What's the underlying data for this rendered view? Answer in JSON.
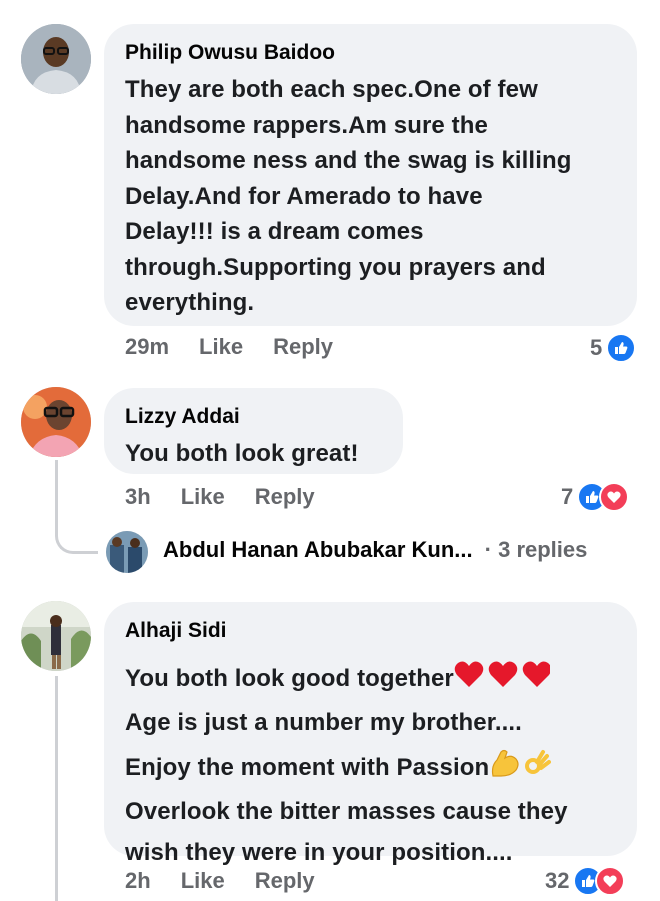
{
  "comments": [
    {
      "author": "Philip Owusu Baidoo",
      "lines": [
        "They are both each spec.One of few",
        "handsome rappers.Am sure the",
        "handsome ness and the swag is killing",
        "Delay.And for Amerado to have",
        "Delay!!! is a dream comes",
        "through.Supporting you prayers and",
        "everything."
      ],
      "time": "29m",
      "like_label": "Like",
      "reply_label": "Reply",
      "reaction_count": "5",
      "reactions": [
        "like-icon"
      ]
    },
    {
      "author": "Lizzy Addai",
      "lines": [
        "You both look great!"
      ],
      "time": "3h",
      "like_label": "Like",
      "reply_label": "Reply",
      "reaction_count": "7",
      "reactions": [
        "like-icon",
        "love-icon"
      ],
      "replies": {
        "author": "Abdul Hanan Abubakar Kun...",
        "count_label": "· 3 replies"
      }
    },
    {
      "author": "Alhaji Sidi",
      "lines": [
        "You both look good together",
        "Age is just a number my brother....",
        "Enjoy the moment with Passion",
        "Overlook the bitter masses cause they",
        "wish they were in your position...."
      ],
      "time": "2h",
      "like_label": "Like",
      "reply_label": "Reply",
      "reaction_count": "32",
      "reactions": [
        "like-icon",
        "love-icon"
      ]
    }
  ],
  "colors": {
    "bubble": "#f0f2f5",
    "meta": "#65676b",
    "like": "#1877f2",
    "love": "#f33e58",
    "heart": "#e5182b"
  }
}
